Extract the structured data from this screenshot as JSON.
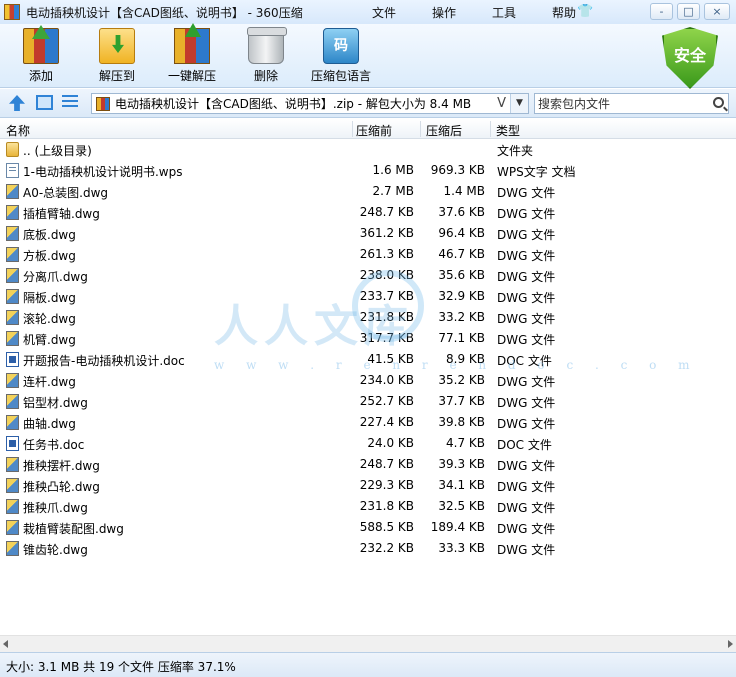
{
  "window": {
    "title": "电动插秧机设计【含CAD图纸、说明书】 - 360压缩"
  },
  "menu": [
    "文件",
    "操作",
    "工具",
    "帮助"
  ],
  "window_controls": {
    "minimize": "-",
    "maximize": "□",
    "close": "×"
  },
  "toolbar": {
    "buttons": [
      {
        "label": "添加",
        "icon": "add-archive-icon"
      },
      {
        "label": "解压到",
        "icon": "extract-folder-icon"
      },
      {
        "label": "一键解压",
        "icon": "one-key-extract-icon"
      },
      {
        "label": "删除",
        "icon": "trash-can-icon"
      },
      {
        "label": "压缩包语言",
        "icon": "archive-language-icon",
        "glyph": "码"
      }
    ],
    "security_badge": "安全"
  },
  "address": {
    "path": "电动插秧机设计【含CAD图纸、说明书】.zip - 解包大小为 8.4 MB",
    "dropdown_glyph": "V"
  },
  "search": {
    "placeholder": "搜索包内文件"
  },
  "columns": {
    "name": "名称",
    "size": "压缩前",
    "packed": "压缩后",
    "type": "类型"
  },
  "files": [
    {
      "name": ".. (上级目录)",
      "size": "",
      "packed": "",
      "type": "文件夹",
      "icon": "folder"
    },
    {
      "name": "1-电动插秧机设计说明书.wps",
      "size": "1.6 MB",
      "packed": "969.3 KB",
      "type": "WPS文字 文档",
      "icon": "wps"
    },
    {
      "name": "A0-总装图.dwg",
      "size": "2.7 MB",
      "packed": "1.4 MB",
      "type": "DWG 文件",
      "icon": "dwg"
    },
    {
      "name": "插植臂轴.dwg",
      "size": "248.7 KB",
      "packed": "37.6 KB",
      "type": "DWG 文件",
      "icon": "dwg"
    },
    {
      "name": "底板.dwg",
      "size": "361.2 KB",
      "packed": "96.4 KB",
      "type": "DWG 文件",
      "icon": "dwg"
    },
    {
      "name": "方板.dwg",
      "size": "261.3 KB",
      "packed": "46.7 KB",
      "type": "DWG 文件",
      "icon": "dwg"
    },
    {
      "name": "分离爪.dwg",
      "size": "238.0 KB",
      "packed": "35.6 KB",
      "type": "DWG 文件",
      "icon": "dwg"
    },
    {
      "name": "隔板.dwg",
      "size": "233.7 KB",
      "packed": "32.9 KB",
      "type": "DWG 文件",
      "icon": "dwg"
    },
    {
      "name": "滚轮.dwg",
      "size": "231.8 KB",
      "packed": "33.2 KB",
      "type": "DWG 文件",
      "icon": "dwg"
    },
    {
      "name": "机臂.dwg",
      "size": "317.7 KB",
      "packed": "77.1 KB",
      "type": "DWG 文件",
      "icon": "dwg"
    },
    {
      "name": "开题报告-电动插秧机设计.doc",
      "size": "41.5 KB",
      "packed": "8.9 KB",
      "type": "DOC 文件",
      "icon": "doc"
    },
    {
      "name": "连杆.dwg",
      "size": "234.0 KB",
      "packed": "35.2 KB",
      "type": "DWG 文件",
      "icon": "dwg"
    },
    {
      "name": "铝型材.dwg",
      "size": "252.7 KB",
      "packed": "37.7 KB",
      "type": "DWG 文件",
      "icon": "dwg"
    },
    {
      "name": "曲轴.dwg",
      "size": "227.4 KB",
      "packed": "39.8 KB",
      "type": "DWG 文件",
      "icon": "dwg"
    },
    {
      "name": "任务书.doc",
      "size": "24.0 KB",
      "packed": "4.7 KB",
      "type": "DOC 文件",
      "icon": "doc"
    },
    {
      "name": "推秧摆杆.dwg",
      "size": "248.7 KB",
      "packed": "39.3 KB",
      "type": "DWG 文件",
      "icon": "dwg"
    },
    {
      "name": "推秧凸轮.dwg",
      "size": "229.3 KB",
      "packed": "34.1 KB",
      "type": "DWG 文件",
      "icon": "dwg"
    },
    {
      "name": "推秧爪.dwg",
      "size": "231.8 KB",
      "packed": "32.5 KB",
      "type": "DWG 文件",
      "icon": "dwg"
    },
    {
      "name": "栽植臂装配图.dwg",
      "size": "588.5 KB",
      "packed": "189.4 KB",
      "type": "DWG 文件",
      "icon": "dwg"
    },
    {
      "name": "锥齿轮.dwg",
      "size": "232.2 KB",
      "packed": "33.3 KB",
      "type": "DWG 文件",
      "icon": "dwg"
    }
  ],
  "watermark": {
    "text": "人人文库",
    "url": "w w w . r e n r e n d o c . c o m"
  },
  "status": "大小: 3.1 MB 共 19 个文件 压缩率 37.1%"
}
